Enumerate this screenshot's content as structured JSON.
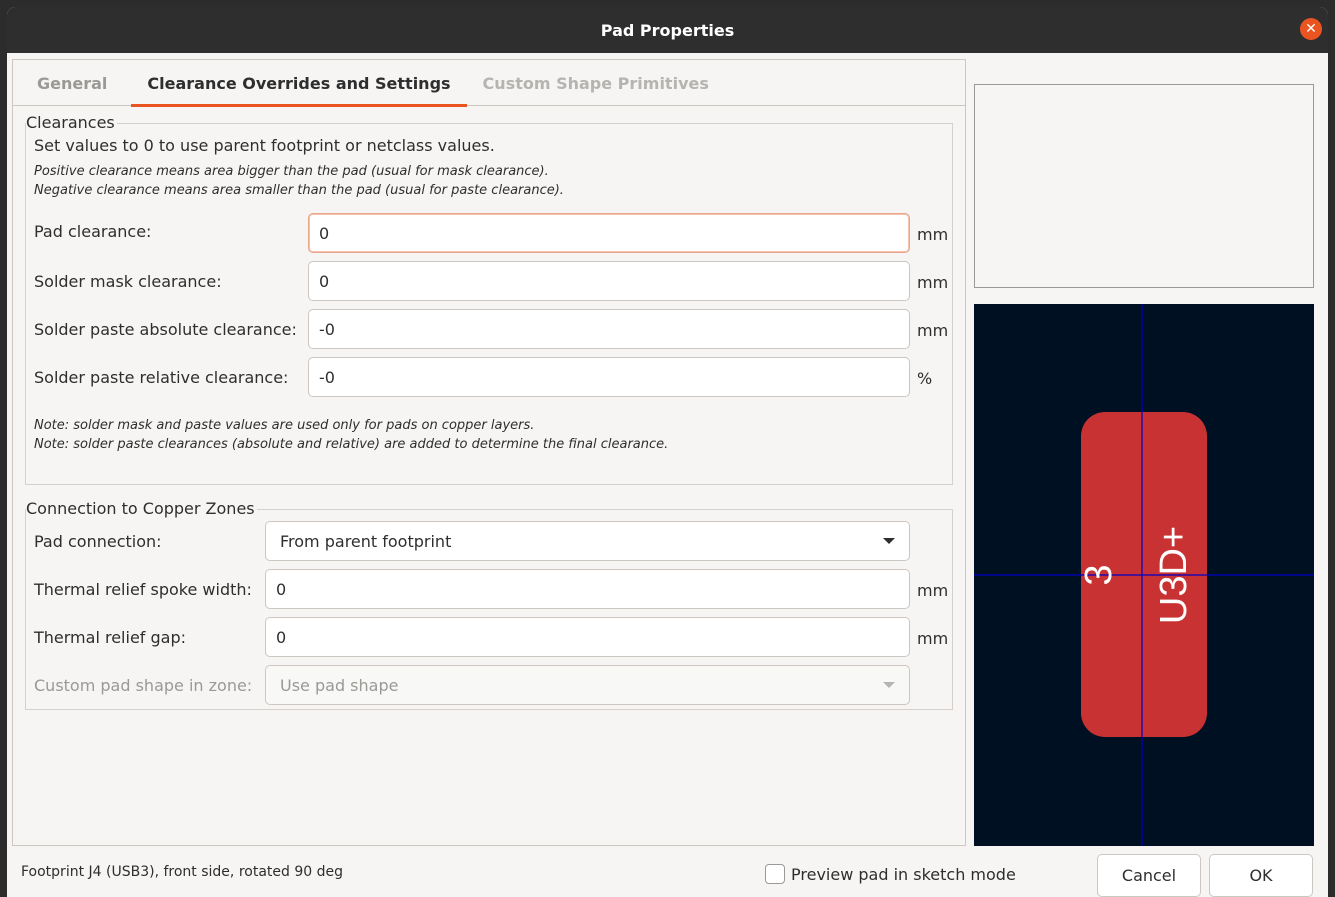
{
  "window": {
    "title": "Pad Properties"
  },
  "tabs": [
    {
      "label": "General",
      "state": "inactive"
    },
    {
      "label": "Clearance Overrides and Settings",
      "state": "active"
    },
    {
      "label": "Custom Shape Primitives",
      "state": "disabled"
    }
  ],
  "clearances": {
    "group_title": "Clearances",
    "intro": "Set values to 0 to use parent footprint or netclass values.",
    "note_positive": "Positive clearance means area bigger than the pad (usual for mask clearance).",
    "note_negative": "Negative clearance means area smaller than the pad (usual for paste clearance).",
    "fields": [
      {
        "label": "Pad clearance:",
        "value": "0",
        "unit": "mm"
      },
      {
        "label": "Solder mask clearance:",
        "value": "0",
        "unit": "mm"
      },
      {
        "label": "Solder paste absolute clearance:",
        "value": "-0",
        "unit": "mm"
      },
      {
        "label": "Solder paste relative clearance:",
        "value": "-0",
        "unit": "%"
      }
    ],
    "note1": "Note: solder mask and paste values are used only for pads on copper layers.",
    "note2": "Note: solder paste clearances (absolute and relative) are added to determine the final clearance."
  },
  "zones": {
    "group_title": "Connection to Copper Zones",
    "pad_connection": {
      "label": "Pad connection:",
      "value": "From parent footprint"
    },
    "spoke_width": {
      "label": "Thermal relief spoke width:",
      "value": "0",
      "unit": "mm"
    },
    "relief_gap": {
      "label": "Thermal relief gap:",
      "value": "0",
      "unit": "mm"
    },
    "custom_shape": {
      "label": "Custom pad shape in zone:",
      "value": "Use pad shape"
    }
  },
  "preview": {
    "pad_number": "3",
    "net_name": "U3D+",
    "pad_color": "#c83232",
    "background_color": "#001023",
    "crosshair_color": "#0000c8"
  },
  "footer": {
    "status": "Footprint J4 (USB3), front side, rotated 90 deg",
    "sketch_mode_label": "Preview pad in sketch mode",
    "cancel_label": "Cancel",
    "ok_label": "OK"
  }
}
